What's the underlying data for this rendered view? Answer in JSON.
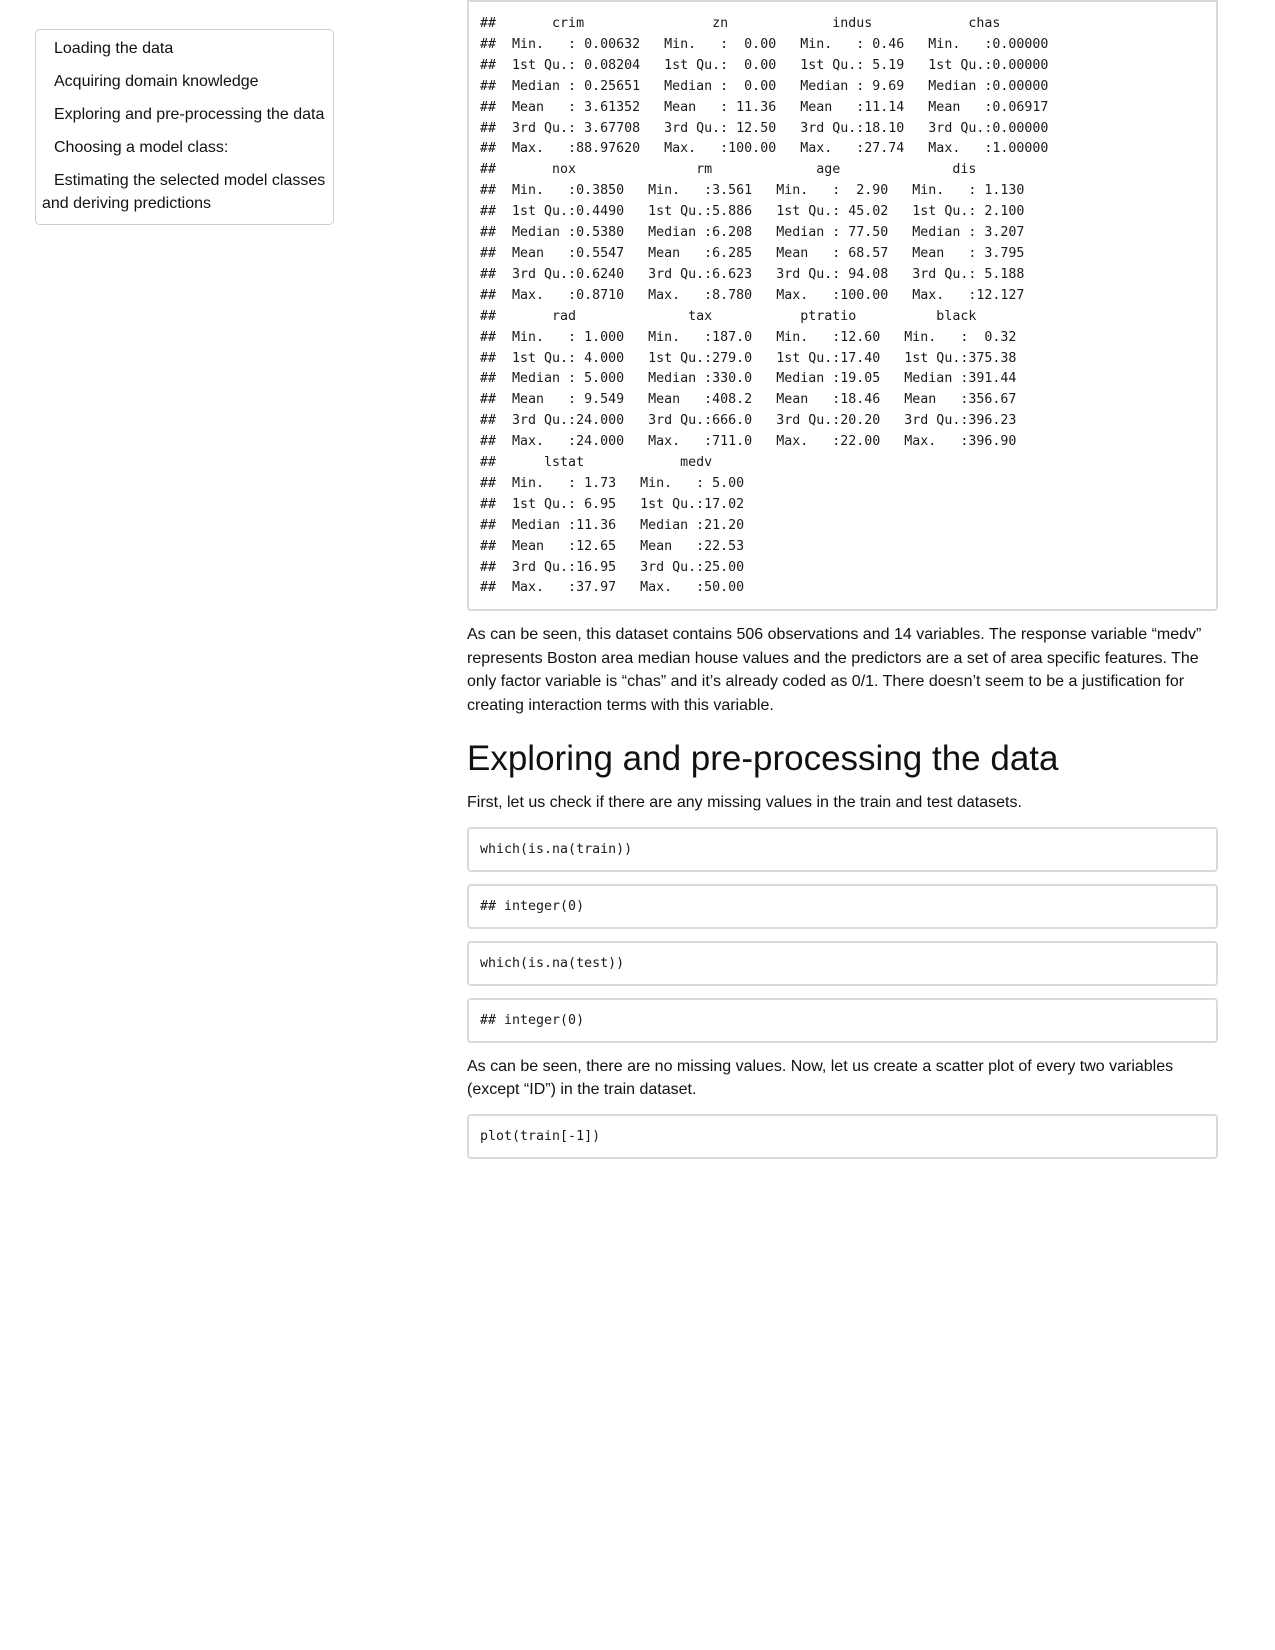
{
  "toc": {
    "items": [
      {
        "label": "Loading the data"
      },
      {
        "label": "Acquiring domain knowledge"
      },
      {
        "label": "Exploring and pre-processing the data"
      },
      {
        "label": "Choosing a model class:"
      },
      {
        "label": "Estimating the selected model classes and deriving predictions"
      }
    ]
  },
  "summary_output": {
    "lines": [
      "##       crim                zn             indus            chas        ",
      "##  Min.   : 0.00632   Min.   :  0.00   Min.   : 0.46   Min.   :0.00000  ",
      "##  1st Qu.: 0.08204   1st Qu.:  0.00   1st Qu.: 5.19   1st Qu.:0.00000  ",
      "##  Median : 0.25651   Median :  0.00   Median : 9.69   Median :0.00000  ",
      "##  Mean   : 3.61352   Mean   : 11.36   Mean   :11.14   Mean   :0.06917  ",
      "##  3rd Qu.: 3.67708   3rd Qu.: 12.50   3rd Qu.:18.10   3rd Qu.:0.00000  ",
      "##  Max.   :88.97620   Max.   :100.00   Max.   :27.74   Max.   :1.00000  ",
      "##       nox               rm             age              dis        ",
      "##  Min.   :0.3850   Min.   :3.561   Min.   :  2.90   Min.   : 1.130  ",
      "##  1st Qu.:0.4490   1st Qu.:5.886   1st Qu.: 45.02   1st Qu.: 2.100  ",
      "##  Median :0.5380   Median :6.208   Median : 77.50   Median : 3.207  ",
      "##  Mean   :0.5547   Mean   :6.285   Mean   : 68.57   Mean   : 3.795  ",
      "##  3rd Qu.:0.6240   3rd Qu.:6.623   3rd Qu.: 94.08   3rd Qu.: 5.188  ",
      "##  Max.   :0.8710   Max.   :8.780   Max.   :100.00   Max.   :12.127  ",
      "##       rad              tax           ptratio          black       ",
      "##  Min.   : 1.000   Min.   :187.0   Min.   :12.60   Min.   :  0.32  ",
      "##  1st Qu.: 4.000   1st Qu.:279.0   1st Qu.:17.40   1st Qu.:375.38  ",
      "##  Median : 5.000   Median :330.0   Median :19.05   Median :391.44  ",
      "##  Mean   : 9.549   Mean   :408.2   Mean   :18.46   Mean   :356.67  ",
      "##  3rd Qu.:24.000   3rd Qu.:666.0   3rd Qu.:20.20   3rd Qu.:396.23  ",
      "##  Max.   :24.000   Max.   :711.0   Max.   :22.00   Max.   :396.90  ",
      "##      lstat            medv      ",
      "##  Min.   : 1.73   Min.   : 5.00  ",
      "##  1st Qu.: 6.95   1st Qu.:17.02  ",
      "##  Median :11.36   Median :21.20  ",
      "##  Mean   :12.65   Mean   :22.53  ",
      "##  3rd Qu.:16.95   3rd Qu.:25.00  ",
      "##  Max.   :37.97   Max.   :50.00  "
    ]
  },
  "paragraphs": {
    "dataset_description": "As can be seen, this dataset contains 506 observations and 14 variables. The response variable “medv” represents Boston area median house values and the predictors are a set of area specific features. The only factor variable is “chas” and it’s already coded as 0/1. There doesn’t seem to be a justification for creating interaction terms with this variable.",
    "missing_intro": "First, let us check if there are any missing values in the train and test datasets.",
    "no_missing": "As can be seen, there are no missing values. Now, let us create a scatter plot of every two variables (except “ID”) in the train dataset."
  },
  "section": {
    "heading": "Exploring and pre-processing the data"
  },
  "code": {
    "na_train": "which(is.na(train))",
    "na_train_output": "## integer(0)",
    "na_test": "which(is.na(test))",
    "na_test_output": "## integer(0)",
    "plot_call": "plot(train[-1])"
  }
}
